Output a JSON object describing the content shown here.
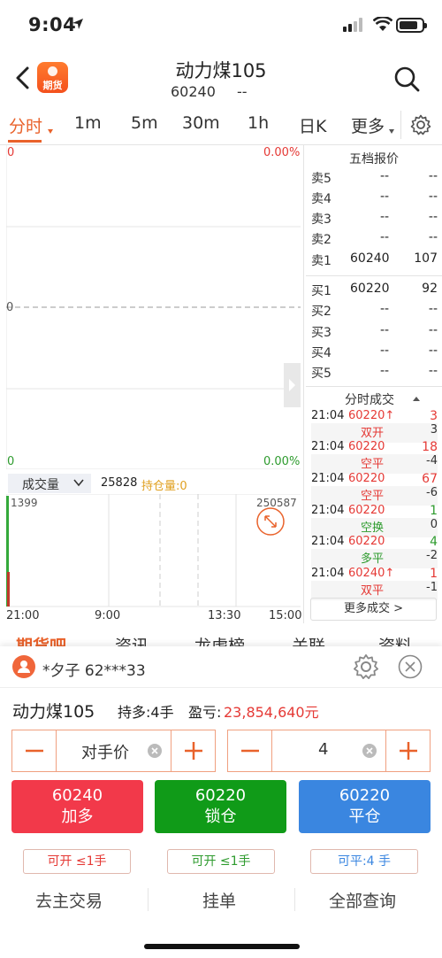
{
  "status": {
    "time": "9:04"
  },
  "header": {
    "app_icon_text": "期货",
    "title": "动力煤105",
    "code": "60240",
    "code_sub": "--"
  },
  "tabs": [
    {
      "label": "分时",
      "active": true
    },
    {
      "label": "1m"
    },
    {
      "label": "5m"
    },
    {
      "label": "30m"
    },
    {
      "label": "1h"
    },
    {
      "label": "日K"
    },
    {
      "label": "更多"
    }
  ],
  "chart": {
    "top_left": "0",
    "top_right": "0.00%",
    "mid_left": "0",
    "bottom_left": "0",
    "bottom_right": "0.00%"
  },
  "volume": {
    "selector": "成交量",
    "value": "25828",
    "oi_label": "持仓量:0",
    "left_value": "1399",
    "right_value": "250587",
    "time_ticks": [
      "21:00",
      "9:00",
      "13:30",
      "15:00"
    ]
  },
  "quote": {
    "title": "五档报价",
    "asks": [
      {
        "label": "卖5",
        "price": "--",
        "vol": "--"
      },
      {
        "label": "卖4",
        "price": "--",
        "vol": "--"
      },
      {
        "label": "卖3",
        "price": "--",
        "vol": "--"
      },
      {
        "label": "卖2",
        "price": "--",
        "vol": "--"
      },
      {
        "label": "卖1",
        "price": "60240",
        "vol": "107"
      }
    ],
    "bids": [
      {
        "label": "买1",
        "price": "60220",
        "vol": "92"
      },
      {
        "label": "买2",
        "price": "--",
        "vol": "--"
      },
      {
        "label": "买3",
        "price": "--",
        "vol": "--"
      },
      {
        "label": "买4",
        "price": "--",
        "vol": "--"
      },
      {
        "label": "买5",
        "price": "--",
        "vol": "--"
      }
    ],
    "trades_title": "分时成交",
    "trades": [
      {
        "time": "21:04",
        "price": "60220↑",
        "vol": "3",
        "type": "双开",
        "delta": "3"
      },
      {
        "time": "21:04",
        "price": "60220",
        "vol": "18",
        "type": "空平",
        "delta": "-4"
      },
      {
        "time": "21:04",
        "price": "60220",
        "vol": "67",
        "type": "空平",
        "delta": "-6"
      },
      {
        "time": "21:04",
        "price": "60220",
        "vol": "1",
        "type": "空换",
        "delta": "0"
      },
      {
        "time": "21:04",
        "price": "60220",
        "vol": "4",
        "type": "多平",
        "delta": "-2"
      },
      {
        "time": "21:04",
        "price": "60240↑",
        "vol": "1",
        "type": "双平",
        "delta": "-1"
      }
    ],
    "more": "更多成交 >"
  },
  "bottom_tabs": [
    "期货吧",
    "资讯",
    "龙虎榜",
    "关联",
    "资料"
  ],
  "panel": {
    "user": "*夕子  62***33",
    "contract": "动力煤105",
    "position": "持多:4手",
    "pnl_label": "盈亏:",
    "pnl": "23,854,640元",
    "price_type": "对手价",
    "qty": "4",
    "btn_buy": {
      "price": "60240",
      "label": "加多"
    },
    "btn_lock": {
      "price": "60220",
      "label": "锁仓"
    },
    "btn_close": {
      "price": "60220",
      "label": "平仓"
    },
    "small1": "可开 ≤1手",
    "small2": "可开 ≤1手",
    "small3": "可平:4 手",
    "actions": [
      "去主交易",
      "挂单",
      "全部查询"
    ]
  },
  "colors": {
    "accent": "#e9622b",
    "red": "#e53935",
    "green": "#2e9b2e",
    "blue": "#3a86e0",
    "btn_red": "#f2394a",
    "btn_green": "#109b18"
  }
}
